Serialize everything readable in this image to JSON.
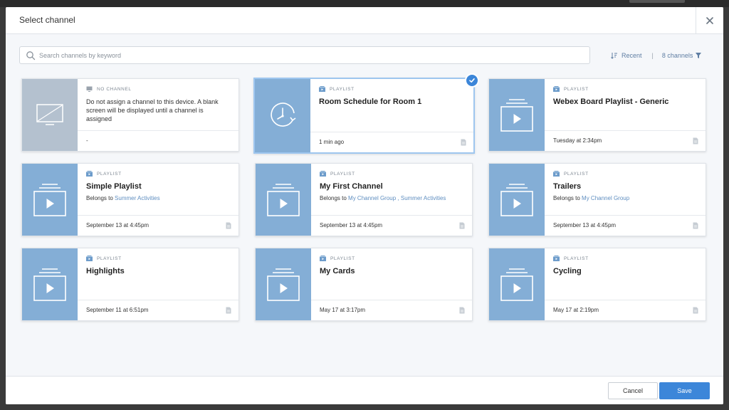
{
  "modal": {
    "title": "Select channel",
    "close_icon": "close-icon"
  },
  "search": {
    "placeholder": "Search channels by keyword",
    "value": ""
  },
  "toolbar": {
    "sort_label": "Recent",
    "separator": "|",
    "count_label": "8 channels"
  },
  "cards": [
    {
      "type": "NO CHANNEL",
      "name": "",
      "description": "Do not assign a channel to this device. A blank screen will be displayed until a channel is assigned",
      "time": "-",
      "thumb_icon": "blank-screen-icon",
      "selected": false
    },
    {
      "type": "PLAYLIST",
      "name": "Room Schedule for Room 1",
      "time": "1 min ago",
      "thumb_icon": "clock-refresh-icon",
      "selected": true
    },
    {
      "type": "PLAYLIST",
      "name": "Webex Board Playlist - Generic",
      "time": "Tuesday at 2:34pm",
      "thumb_icon": "playlist-icon",
      "selected": false
    },
    {
      "type": "PLAYLIST",
      "name": "Simple Playlist",
      "belongs_prefix": "Belongs to",
      "groups": "Summer Activities",
      "time": "September 13 at 4:45pm",
      "thumb_icon": "playlist-icon",
      "selected": false
    },
    {
      "type": "PLAYLIST",
      "name": "My First Channel",
      "belongs_prefix": "Belongs to",
      "groups": "My Channel Group , Summer Activities",
      "time": "September 13 at 4:45pm",
      "thumb_icon": "playlist-icon",
      "selected": false
    },
    {
      "type": "PLAYLIST",
      "name": "Trailers",
      "belongs_prefix": "Belongs to",
      "groups": "My Channel Group",
      "time": "September 13 at 4:45pm",
      "thumb_icon": "playlist-icon",
      "selected": false
    },
    {
      "type": "PLAYLIST",
      "name": "Highlights",
      "time": "September 11 at 6:51pm",
      "thumb_icon": "playlist-icon",
      "selected": false
    },
    {
      "type": "PLAYLIST",
      "name": "My Cards",
      "time": "May 17 at 3:17pm",
      "thumb_icon": "playlist-icon",
      "selected": false
    },
    {
      "type": "PLAYLIST",
      "name": "Cycling",
      "time": "May 17 at 2:19pm",
      "thumb_icon": "playlist-icon",
      "selected": false
    }
  ],
  "footer": {
    "cancel_label": "Cancel",
    "save_label": "Save"
  },
  "colors": {
    "accent": "#3c86d9",
    "thumb": "#84aed6",
    "thumb_none": "#b4c1cf",
    "selected_border": "#9ec6ef"
  }
}
